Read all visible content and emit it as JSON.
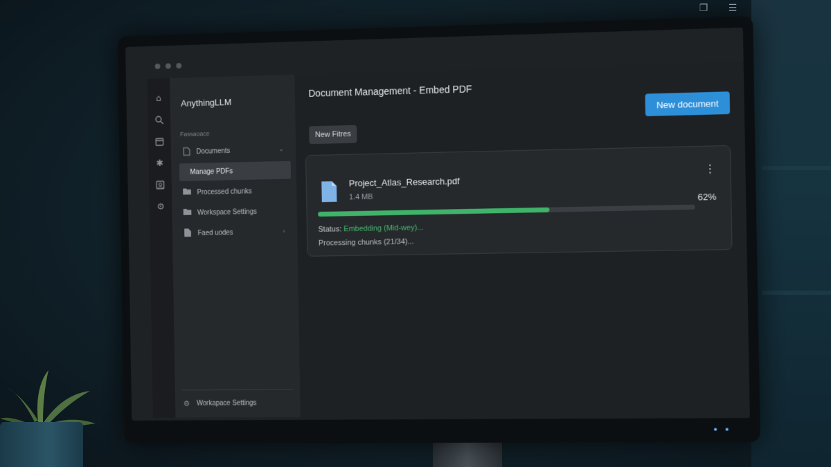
{
  "app": {
    "name": "AnythingLLM",
    "workspace_label": "Fassaoace"
  },
  "sidebar": {
    "items": [
      {
        "label": "Documents",
        "icon": "file-icon",
        "chevron": "⌄"
      },
      {
        "label": "Manage PDFs",
        "icon": "",
        "active": true
      },
      {
        "label": "Processed chunks",
        "icon": "folder-icon"
      },
      {
        "label": "Workspace Settings",
        "icon": "folder-icon"
      },
      {
        "label": "Faed uodes",
        "icon": "file-icon",
        "chevron": "›"
      }
    ],
    "bottom_label": "Workapace Settings"
  },
  "page": {
    "title": "Document Management - Embed PDF",
    "new_document_label": "New document",
    "new_files_label": "New Fitres"
  },
  "document": {
    "name": "Project_Atlas_Research.pdf",
    "size": "1.4 MB",
    "progress_label": "62%",
    "progress_value": 62,
    "status_prefix": "Status:",
    "status_value": "Embedding (Mid-wey)...",
    "processing_text": "Processing chunks (21/34)..."
  },
  "colors": {
    "accent_blue": "#2d8fd8",
    "progress_green": "#3fb36a",
    "status_green": "#45b96e",
    "screen_bg": "#1e2124",
    "sidebar_bg": "#26292c"
  },
  "icons": {
    "rail": [
      "home-icon",
      "search-icon",
      "calendar-icon",
      "bug-icon",
      "contacts-icon",
      "gear-icon"
    ],
    "top_right": [
      "copy-icon",
      "list-icon"
    ]
  }
}
